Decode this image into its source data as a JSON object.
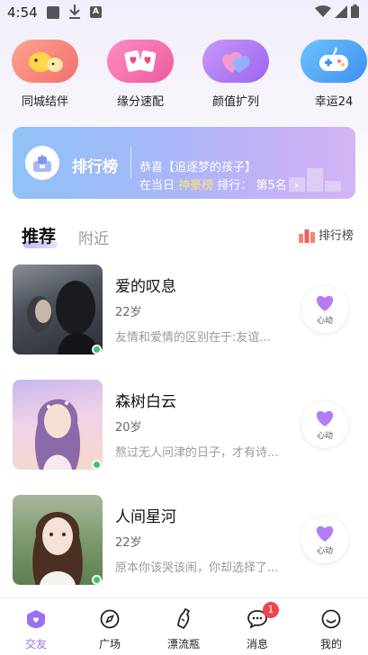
{
  "status_bar": {
    "time": "4:54"
  },
  "features": [
    {
      "label": "同城结伴",
      "icon": "duck-chat-icon",
      "color": "#f98a7c"
    },
    {
      "label": "缘分速配",
      "icon": "heart-cards-icon",
      "color": "#f56fa8"
    },
    {
      "label": "颜值扩列",
      "icon": "hearts-icon",
      "color": "#b07cf5"
    },
    {
      "label": "幸运24",
      "icon": "gamepad-icon",
      "color": "#4aa8f5"
    }
  ],
  "banner": {
    "title": "排行榜",
    "line1": "恭喜【追逐梦的孩子】",
    "line2_prefix": "在当日",
    "line2_highlight": "神豪榜",
    "line2_suffix": "排行：",
    "rank": "第5名"
  },
  "tabs": {
    "active": "推荐",
    "inactive": "附近",
    "rank_link": "排行榜"
  },
  "users": [
    {
      "name": "爱的叹息",
      "age": "22岁",
      "bio": "友情和爱情的区别在于:友谊...",
      "action": "心动"
    },
    {
      "name": "森树白云",
      "age": "20岁",
      "bio": "熬过无人问津的日子，才有诗...",
      "action": "心动"
    },
    {
      "name": "人间星河",
      "age": "22岁",
      "bio": "原本你该哭该闹，你却选择了...",
      "action": "心动"
    }
  ],
  "nav": {
    "items": [
      {
        "label": "交友",
        "icon": "home-shield-icon"
      },
      {
        "label": "广场",
        "icon": "compass-icon"
      },
      {
        "label": "漂流瓶",
        "icon": "bottle-icon"
      },
      {
        "label": "消息",
        "icon": "chat-bubble-icon"
      },
      {
        "label": "我的",
        "icon": "smile-face-icon"
      }
    ],
    "message_badge": "1",
    "accent": "#9b6ef3"
  }
}
